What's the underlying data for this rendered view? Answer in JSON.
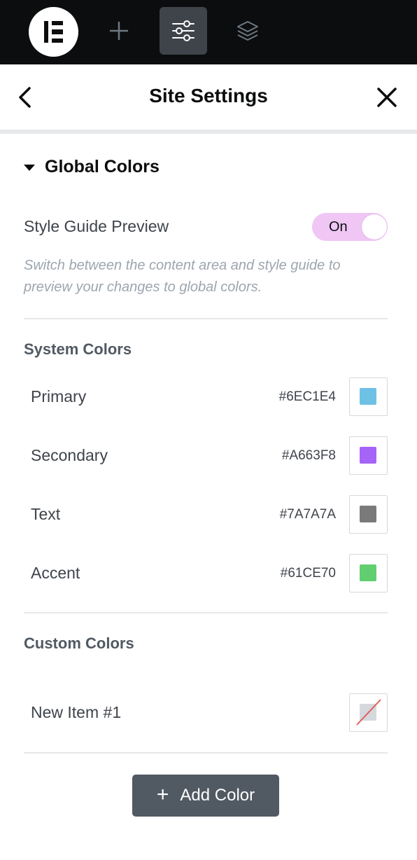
{
  "topbar": {
    "icons": [
      "elementor-logo-icon",
      "plus-icon",
      "sliders-icon",
      "layers-icon"
    ]
  },
  "header": {
    "title": "Site Settings",
    "back_icon": "chevron-left-icon",
    "close_icon": "close-icon"
  },
  "section": {
    "title": "Global Colors",
    "style_guide": {
      "label": "Style Guide Preview",
      "toggle_label": "On",
      "description": "Switch between the content area and style guide to preview your changes to global colors."
    }
  },
  "system_colors": {
    "title": "System Colors",
    "items": [
      {
        "label": "Primary",
        "hex": "#6EC1E4"
      },
      {
        "label": "Secondary",
        "hex": "#A663F8"
      },
      {
        "label": "Text",
        "hex": "#7A7A7A"
      },
      {
        "label": "Accent",
        "hex": "#61CE70"
      }
    ]
  },
  "custom_colors": {
    "title": "Custom Colors",
    "items": [
      {
        "label": "New Item #1"
      }
    ]
  },
  "actions": {
    "add_color_label": "Add Color"
  },
  "colors": {
    "topbar_bg": "#0c0d0e",
    "active_tool_bg": "#3f444b",
    "toggle_bg": "#f0c6f5",
    "button_bg": "#515962"
  }
}
